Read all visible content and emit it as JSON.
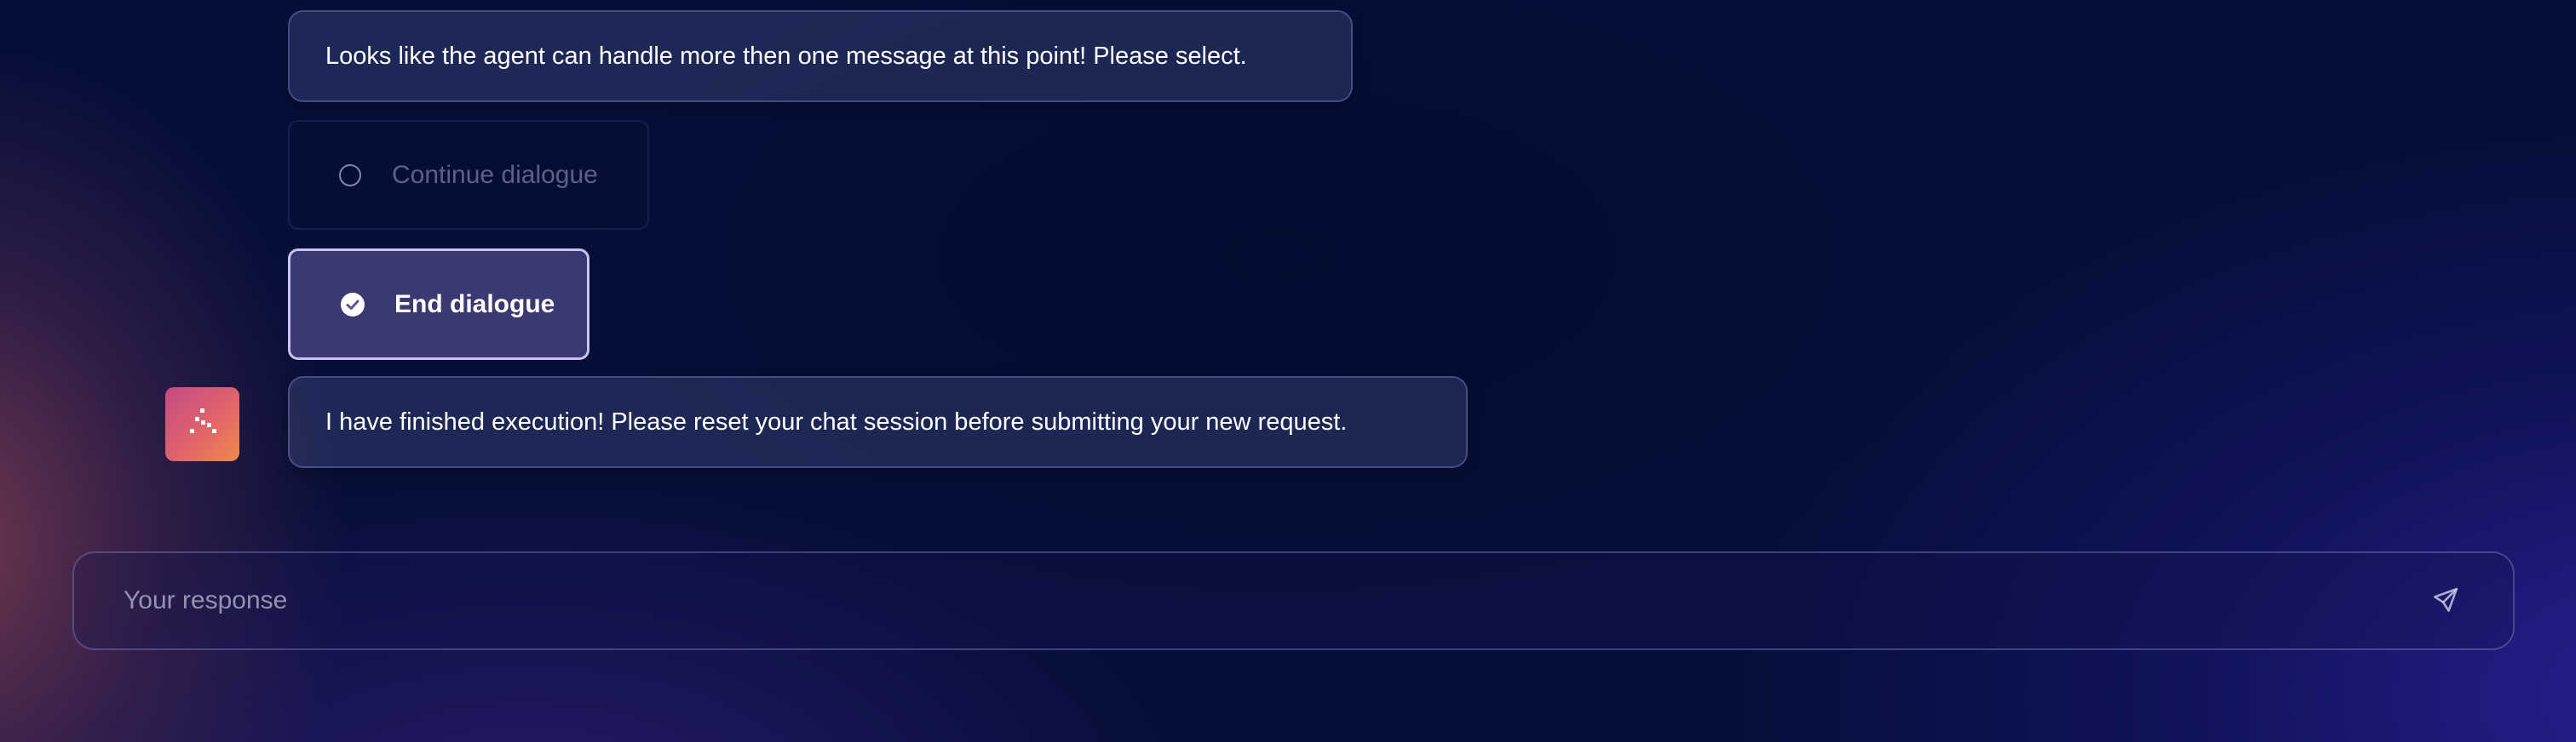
{
  "messages": {
    "selection_prompt": "Looks like the agent can handle more then one message at this point! Please select.",
    "finished": "I have finished execution! Please reset your chat session before submitting your new request."
  },
  "options": [
    {
      "label": "Continue dialogue",
      "selected": false,
      "icon": "radio-empty-icon"
    },
    {
      "label": "End dialogue",
      "selected": true,
      "icon": "check-circle-icon"
    }
  ],
  "agent": {
    "avatar_icon": "agent-dots-icon",
    "avatar_gradient": [
      "#c44a86",
      "#f08a4a"
    ]
  },
  "composer": {
    "placeholder": "Your response",
    "value": "",
    "send_icon": "send-icon"
  },
  "colors": {
    "background": "#060f3a",
    "selected_border": "#c9c2f2"
  }
}
